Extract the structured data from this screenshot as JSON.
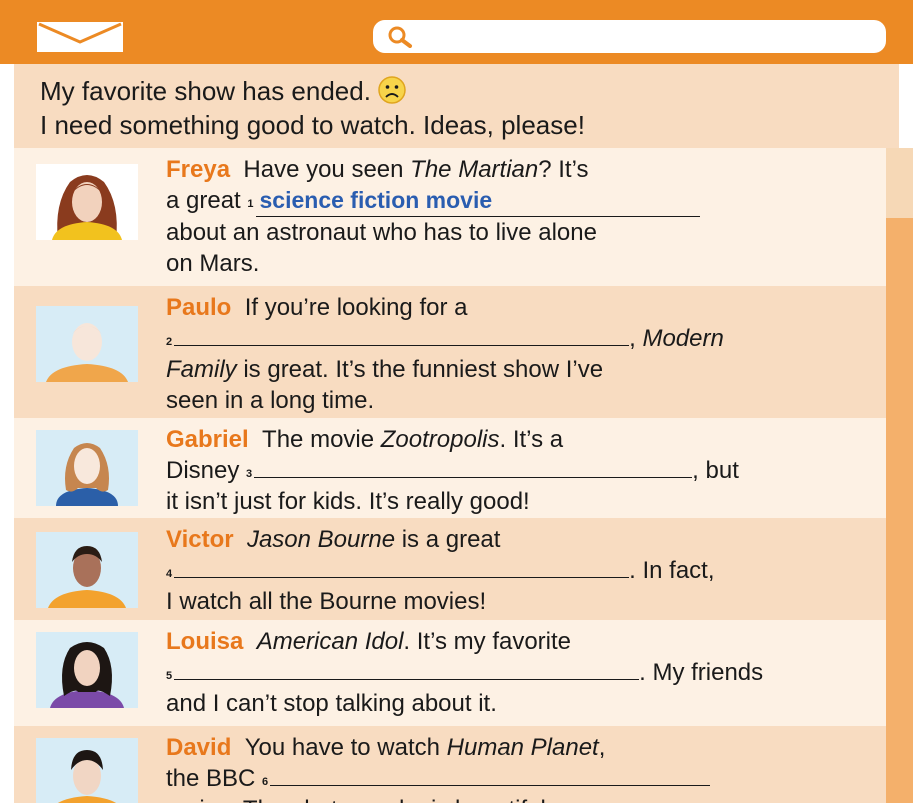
{
  "topbar": {
    "mail_icon": "envelope-icon",
    "search_icon": "magnifier-icon",
    "search_value": "",
    "accent_color": "#ec8a24"
  },
  "post": {
    "line1": "My favorite show has ended.",
    "line2": "I need something good to watch. Ideas, please!",
    "emoji_icon": "sad-face-icon"
  },
  "replies": [
    {
      "name": "Freya",
      "l1_a": "Have you seen ",
      "l1_title": "The Martian",
      "l1_b": "? It’s",
      "l2_pre": "a great ",
      "num": "1",
      "answer": "science fiction movie",
      "l3": "about an astronaut who has to live alone",
      "l4": "on Mars."
    },
    {
      "name": "Paulo",
      "l1": "If you’re looking for a",
      "num": "2",
      "l2_post": ", ",
      "l2_title": "Modern",
      "l3_title": "Family",
      "l3_rest": " is great. It’s the funniest show I’ve",
      "l4": "seen in a long time."
    },
    {
      "name": "Gabriel",
      "l1_a": "The movie ",
      "l1_title": "Zootropolis",
      "l1_b": ". It’s a",
      "l2_pre": "Disney ",
      "num": "3",
      "l2_post": ", but",
      "l3": "it isn’t just for kids. It’s really good!"
    },
    {
      "name": "Victor",
      "l1_title": "Jason Bourne",
      "l1_b": " is a great",
      "num": "4",
      "l2_post": ". In fact,",
      "l3": "I watch all the Bourne movies!"
    },
    {
      "name": "Louisa",
      "l1_title": "American Idol",
      "l1_b": ". It’s my favorite",
      "num": "5",
      "l2_post": ". My friends",
      "l3": "and I can’t stop talking about it."
    },
    {
      "name": "David",
      "l1_a": "You have to watch ",
      "l1_title": "Human Planet",
      "l1_b": ",",
      "l2_pre": "the BBC ",
      "num": "6",
      "l3": "series. The photography is beautiful."
    }
  ]
}
